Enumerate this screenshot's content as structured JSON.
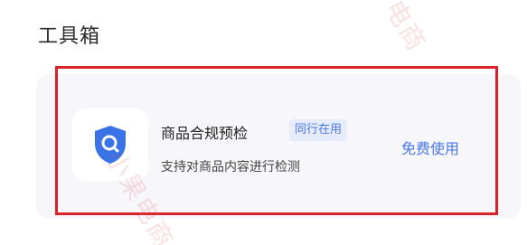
{
  "section": {
    "title": "工具箱"
  },
  "tool": {
    "name": "商品合规预检",
    "badge": "同行在用",
    "description": "支持对商品内容进行检测",
    "action_label": "免费使用",
    "icon": "shield-search-icon"
  },
  "watermark": {
    "text_top": "电商",
    "text_bottom": "小果电商"
  },
  "colors": {
    "accent": "#4a78e6",
    "highlight": "#d8232a",
    "card_background": "#f6f6fb",
    "badge_background": "#e6ecfb"
  }
}
